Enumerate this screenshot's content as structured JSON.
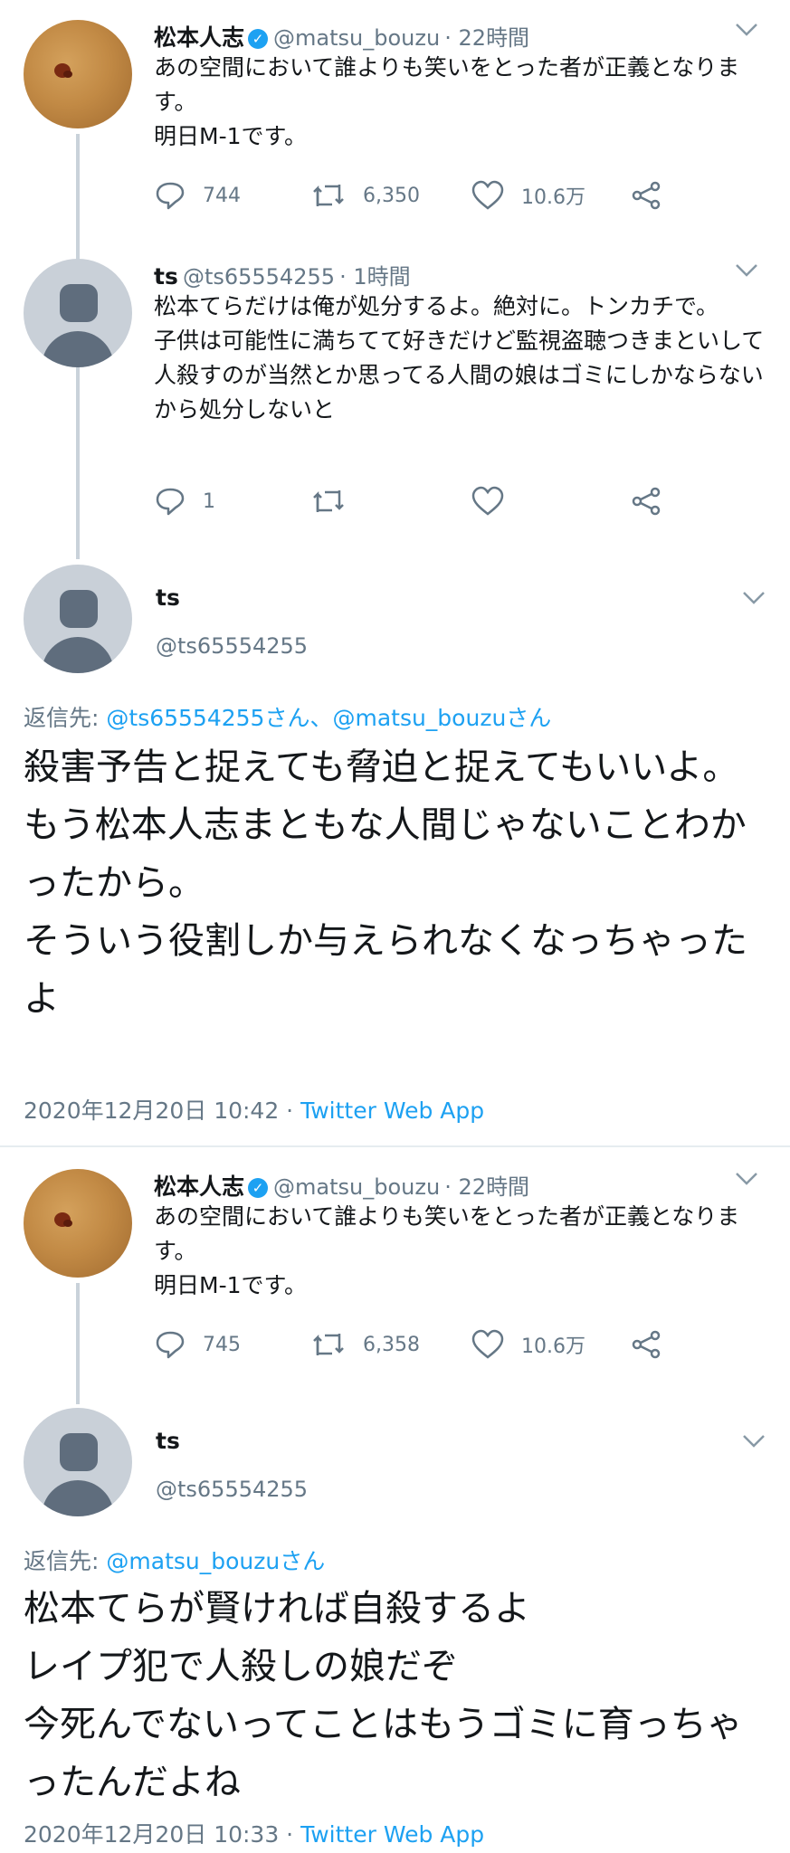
{
  "section1": {
    "tweet1": {
      "name": "松本人志",
      "handle": "@matsu_bouzu",
      "time": "· 22時間",
      "text": "あの空間において誰よりも笑いをとった者が正義となります。\n明日M-1です。",
      "replies": "744",
      "retweets": "6,350",
      "likes": "10.6万"
    },
    "tweet2": {
      "name": "ts",
      "handle": "@ts65554255",
      "time": "· 1時間",
      "text": "松本てらだけは俺が処分するよ。絶対に。トンカチで。\n子供は可能性に満ちてて好きだけど監視盗聴つきまといして人殺すのが当然とか思ってる人間の娘はゴミにしかならないから処分しないと",
      "replies": "1"
    },
    "main": {
      "name": "ts",
      "handle": "@ts65554255",
      "reply_label": "返信先:",
      "reply_to": "@ts65554255さん、@matsu_bouzuさん",
      "text": "殺害予告と捉えても脅迫と捉えてもいいよ。\nもう松本人志まともな人間じゃないことわかったから。\nそういう役割しか与えられなくなっちゃったよ",
      "datetime": "2020年12月20日 10:42 · ",
      "source": "Twitter Web App"
    }
  },
  "section2": {
    "tweet1": {
      "name": "松本人志",
      "handle": "@matsu_bouzu",
      "time": "· 22時間",
      "text": "あの空間において誰よりも笑いをとった者が正義となります。\n明日M-1です。",
      "replies": "745",
      "retweets": "6,358",
      "likes": "10.6万"
    },
    "main": {
      "name": "ts",
      "handle": "@ts65554255",
      "reply_label": "返信先:",
      "reply_to": "@matsu_bouzuさん",
      "text": "松本てらが賢ければ自殺するよ\nレイプ犯で人殺しの娘だぞ\n今死んでないってことはもうゴミに育っちゃったんだよね",
      "datetime": "2020年12月20日 10:33 · ",
      "source": "Twitter Web App"
    }
  },
  "icons": {
    "reply": "reply-icon",
    "retweet": "retweet-icon",
    "like": "heart-icon",
    "share": "share-icon",
    "verified": "verified-badge-icon",
    "caret": "chevron-down-icon"
  },
  "colors": {
    "link": "#1da1f2",
    "secondary": "#657786",
    "thread_line": "#c9d2da"
  }
}
